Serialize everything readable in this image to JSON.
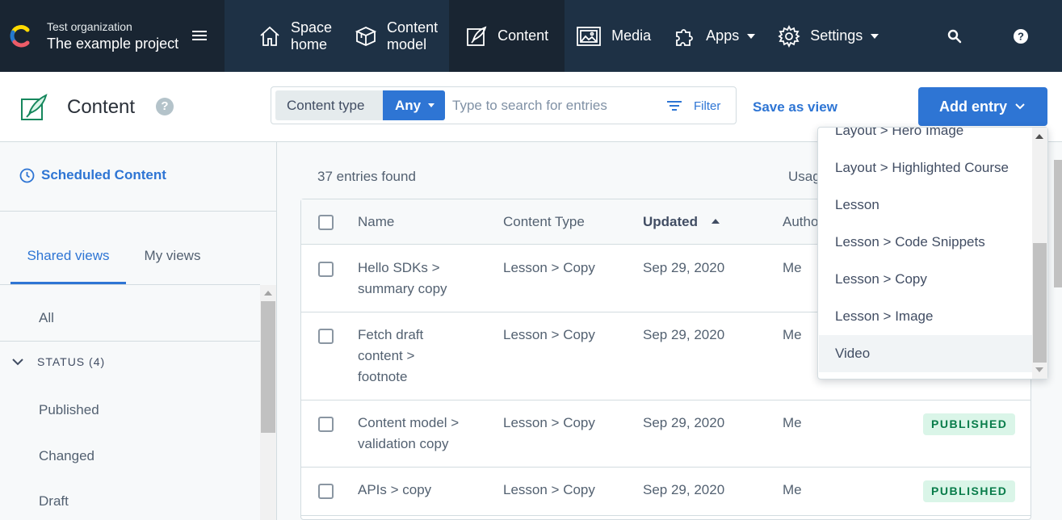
{
  "colors": {
    "nav_bg": "#1e3145",
    "nav_dark": "#192532",
    "accent": "#2e75d4",
    "published_bg": "#daf5e8",
    "published_text": "#087c4a"
  },
  "org": {
    "name": "Test organization",
    "project": "The example project",
    "logo_icon": "contentful-logo-icon",
    "menu_icon": "hamburger-icon"
  },
  "nav": {
    "space_home": {
      "line1": "Space",
      "line2": "home",
      "icon": "home-icon"
    },
    "content_model": {
      "line1": "Content",
      "line2": "model",
      "icon": "content-model-icon"
    },
    "content": {
      "label": "Content",
      "icon": "pen-icon"
    },
    "media": {
      "label": "Media",
      "icon": "media-icon"
    },
    "apps": {
      "label": "Apps",
      "icon": "puzzle-icon"
    },
    "settings": {
      "label": "Settings",
      "icon": "gear-icon"
    },
    "search_icon": "search-icon",
    "help_icon": "help-icon"
  },
  "header": {
    "title": "Content",
    "help": "?",
    "content_type_label": "Content type",
    "content_type_value": "Any",
    "search_placeholder": "Type to search for entries",
    "filter_label": "Filter",
    "save_view_label": "Save as view",
    "add_entry_label": "Add entry"
  },
  "sidebar": {
    "scheduled": "Scheduled Content",
    "tabs": [
      {
        "label": "Shared views",
        "active": true
      },
      {
        "label": "My views",
        "active": false
      }
    ],
    "all": "All",
    "status_group": "STATUS (4)",
    "views": [
      "Published",
      "Changed",
      "Draft"
    ]
  },
  "main": {
    "entries_found": "37 entries found",
    "usage_partial": "Usag",
    "columns": [
      "Name",
      "Content Type",
      "Updated",
      "Autho"
    ],
    "sort": {
      "column": "Updated",
      "direction": "ascending"
    },
    "rows": [
      {
        "name": [
          "Hello SDKs >",
          "summary copy"
        ],
        "content_type": "Lesson > Copy",
        "updated": "Sep 29, 2020",
        "author": "Me",
        "status": ""
      },
      {
        "name": [
          "Fetch draft",
          "content >",
          "footnote"
        ],
        "content_type": "Lesson > Copy",
        "updated": "Sep 29, 2020",
        "author": "Me",
        "status": ""
      },
      {
        "name": [
          "Content model >",
          "validation copy"
        ],
        "content_type": "Lesson > Copy",
        "updated": "Sep 29, 2020",
        "author": "Me",
        "status": "PUBLISHED"
      },
      {
        "name": [
          "APIs > copy"
        ],
        "content_type": "Lesson > Copy",
        "updated": "Sep 29, 2020",
        "author": "Me",
        "status": "PUBLISHED"
      }
    ]
  },
  "dropdown": {
    "items": [
      "Layout > Hero Image",
      "Layout > Highlighted Course",
      "Lesson",
      "Lesson > Code Snippets",
      "Lesson > Copy",
      "Lesson > Image",
      "Video"
    ],
    "hovered": "Video"
  }
}
